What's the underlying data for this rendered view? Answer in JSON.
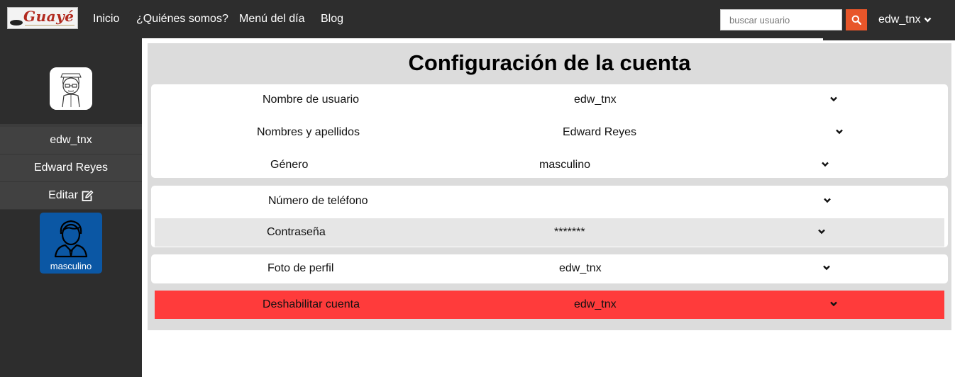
{
  "brand": {
    "logo_text": "Guayé"
  },
  "nav": {
    "links": [
      "Inicio",
      "¿Quiénes somos?",
      "Menú del día",
      "Blog"
    ],
    "search_placeholder": "buscar usuario",
    "user_label": "edw_tnx"
  },
  "sidebar": {
    "username": "edw_tnx",
    "full_name": "Edward Reyes",
    "edit_label": "Editar",
    "gender_label": "masculino"
  },
  "main": {
    "title": "Configuración de la cuenta",
    "rows": [
      {
        "label": "Nombre de usuario",
        "value": "edw_tnx"
      },
      {
        "label": "Nombres y apellidos",
        "value": "Edward Reyes"
      },
      {
        "label": "Género",
        "value": "masculino"
      },
      {
        "label": "Número de teléfono",
        "value": ""
      },
      {
        "label": "Contraseña",
        "value": "*******"
      },
      {
        "label": "Foto de perfil",
        "value": "edw_tnx"
      },
      {
        "label": "Deshabilitar cuenta",
        "value": "edw_tnx"
      }
    ]
  },
  "colors": {
    "navbar": "#2d2d2d",
    "search_button": "#e8562a",
    "gender_badge": "#0b57a4",
    "danger_row": "#ff3b3b",
    "panel": "#dcdcdc"
  },
  "icons": {
    "search": "search-icon",
    "user_chevron": "chevron-down-icon",
    "edit": "edit-icon",
    "avatar_person": "male-user-icon"
  }
}
